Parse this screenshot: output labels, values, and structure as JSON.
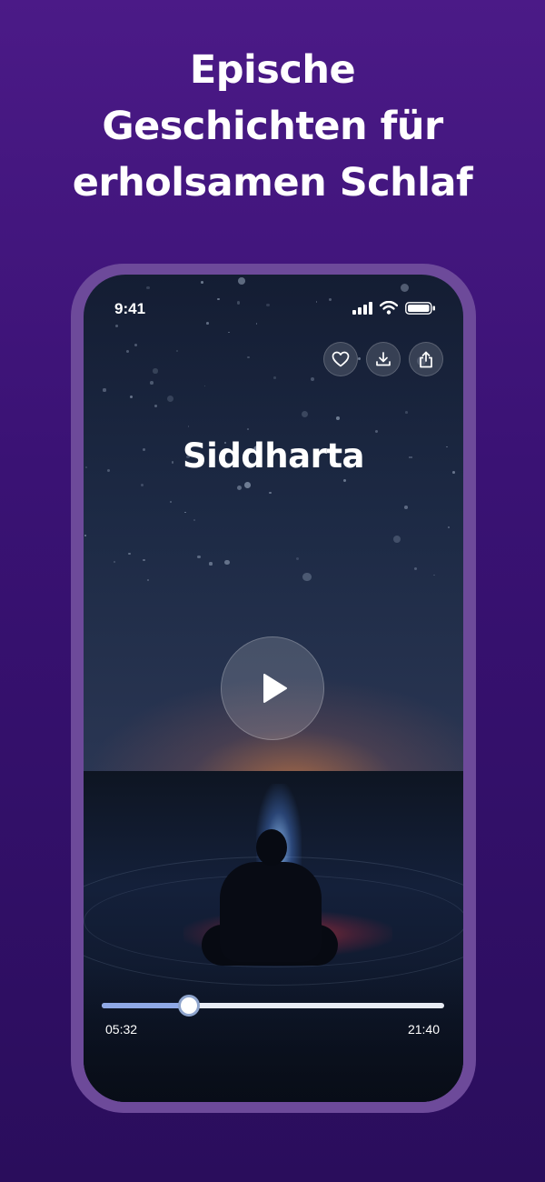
{
  "headline": {
    "line1": "Epische",
    "line2": "Geschichten für",
    "line3": "erholsamen Schlaf"
  },
  "status_bar": {
    "time": "9:41"
  },
  "player": {
    "title": "Siddharta",
    "elapsed": "05:32",
    "total": "21:40",
    "progress_fraction": 0.255,
    "actions": [
      "heart-icon",
      "download-icon",
      "share-icon"
    ]
  },
  "colors": {
    "background": "#3a1274",
    "frame": "#6d4a9a",
    "progress_fill": "#8fa9e6",
    "progress_track": "#e8ecf4"
  }
}
